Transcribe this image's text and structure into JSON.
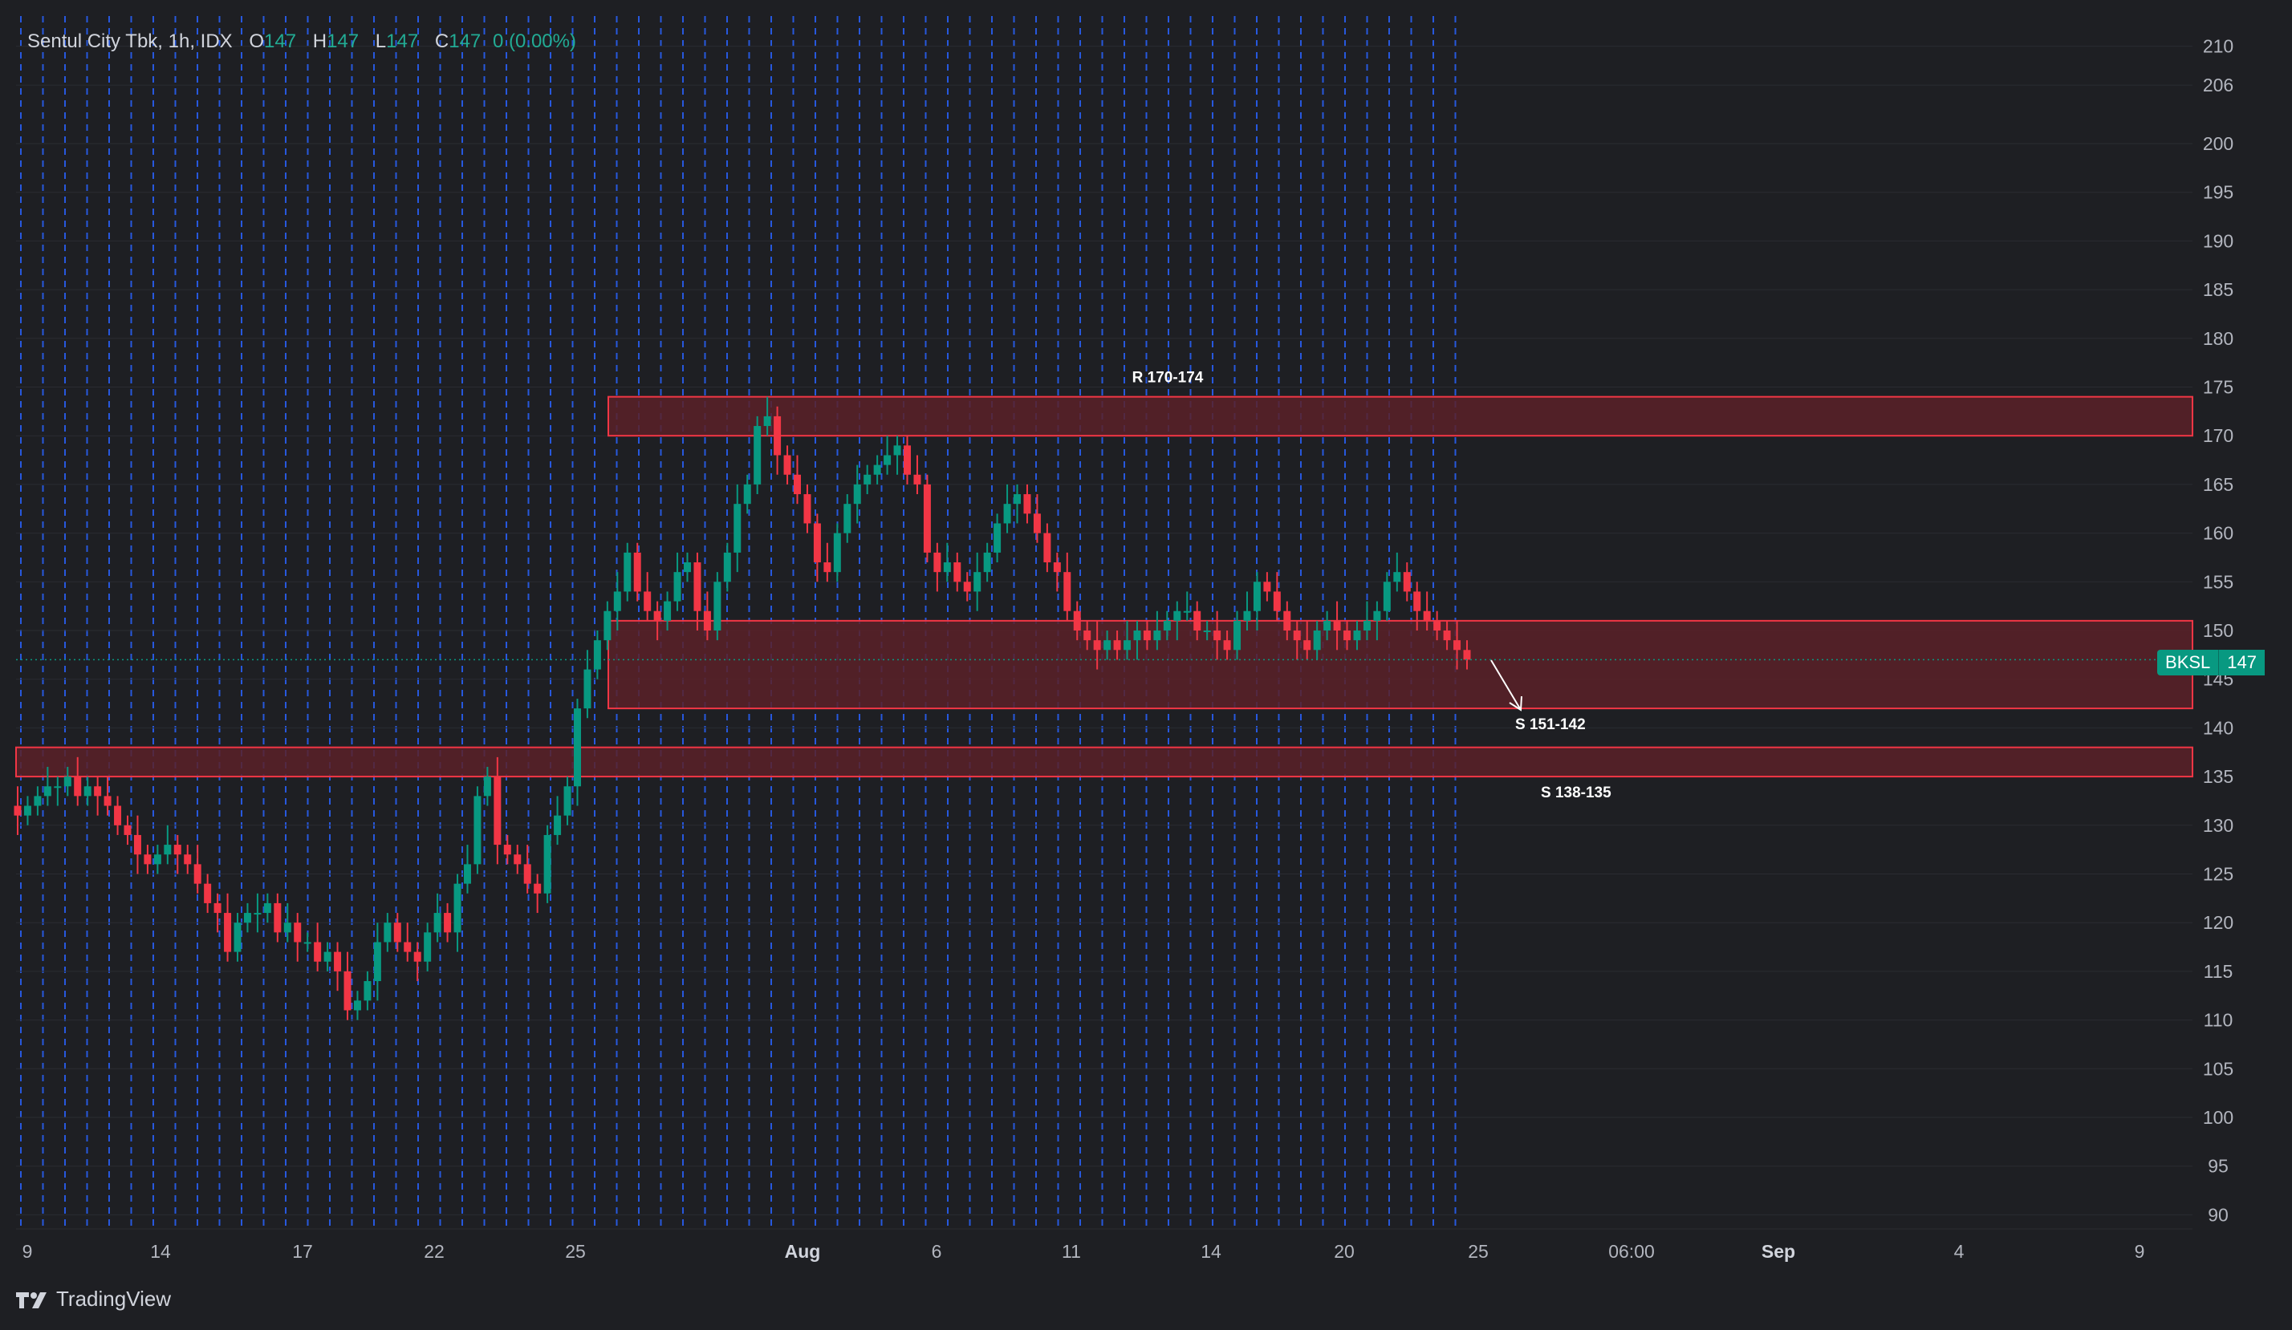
{
  "legend": {
    "title": "Sentul City Tbk, 1h, IDX",
    "open_label": "O",
    "open": "147",
    "high_label": "H",
    "high": "147",
    "low_label": "L",
    "low": "147",
    "close_label": "C",
    "close": "147",
    "change": "0 (0.00%)"
  },
  "price_tag": {
    "symbol": "BKSL",
    "value": "147"
  },
  "brand": {
    "label": "TradingView"
  },
  "colors": {
    "background": "#1e1f23",
    "up": "#089981",
    "down": "#f23645",
    "zone_fill": "#5a2128",
    "zone_border": "#f23645",
    "vline": "#2962ff"
  },
  "chart_data": {
    "type": "candlestick",
    "interval": "1h",
    "yaxis_ticks": [
      210,
      206,
      200,
      195,
      190,
      185,
      180,
      175,
      170,
      165,
      160,
      155,
      150,
      145,
      140,
      135,
      130,
      125,
      120,
      115,
      110,
      105,
      100,
      95,
      90
    ],
    "ylim": [
      89,
      212
    ],
    "xaxis_ticks": [
      "9",
      "14",
      "17",
      "22",
      "25",
      "Aug",
      "6",
      "11",
      "14",
      "20",
      "25",
      "06:00",
      "Sep",
      "4",
      "9"
    ],
    "last_price": 147,
    "zones": [
      {
        "label": "R 170-174",
        "low": 170,
        "high": 174
      },
      {
        "label": "S 151-142",
        "low": 142,
        "high": 151
      },
      {
        "label": "S 138-135",
        "low": 135,
        "high": 138
      }
    ],
    "closes": [
      131,
      132,
      133,
      134,
      134,
      135,
      133,
      134,
      133,
      132,
      130,
      129,
      127,
      126,
      127,
      128,
      127,
      126,
      124,
      122,
      121,
      117,
      120,
      121,
      121,
      122,
      119,
      120,
      118,
      118,
      116,
      117,
      115,
      111,
      112,
      114,
      118,
      120,
      118,
      117,
      116,
      119,
      121,
      119,
      124,
      126,
      133,
      135,
      128,
      127,
      126,
      124,
      123,
      129,
      131,
      134,
      142,
      146,
      149,
      152,
      154,
      158,
      154,
      152,
      151,
      153,
      156,
      157,
      152,
      150,
      155,
      158,
      163,
      165,
      171,
      172,
      168,
      166,
      164,
      161,
      157,
      156,
      160,
      163,
      165,
      166,
      167,
      168,
      169,
      166,
      165,
      158,
      156,
      157,
      155,
      154,
      156,
      158,
      161,
      163,
      164,
      162,
      160,
      157,
      156,
      152,
      150,
      149,
      148,
      149,
      148,
      149,
      150,
      149,
      150,
      151,
      152,
      152,
      150,
      150,
      149,
      148,
      151,
      152,
      155,
      154,
      152,
      150,
      149,
      148,
      150,
      151,
      150,
      149,
      150,
      151,
      152,
      155,
      156,
      154,
      152,
      151,
      150,
      149,
      148,
      147
    ]
  }
}
